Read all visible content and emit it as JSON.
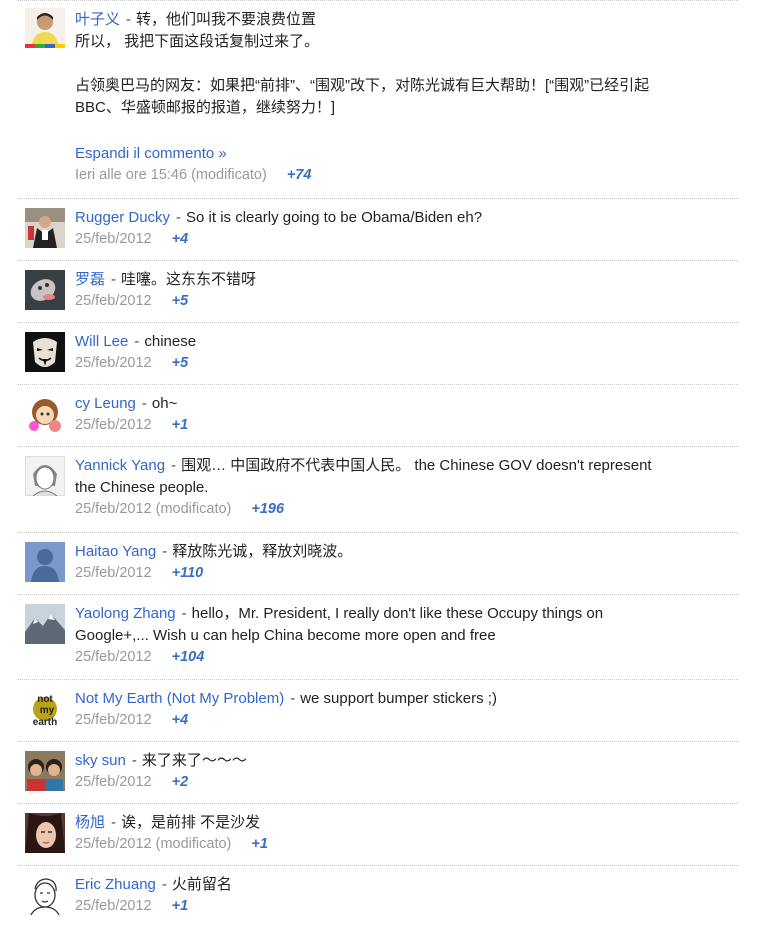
{
  "comments": [
    {
      "author": "叶子义",
      "text": "转，他们叫我不要浪费位置",
      "line2": "所以， 我把下面这段话复制过来了。",
      "para_a": "占领奥巴马的网友：如果把“前排”、“围观”改下，对陈光诚有巨大帮助！[“围观”已经引起",
      "para_b": "BBC、华盛顿邮报的报道，继续努力！]",
      "expand": "Espandi il commento »",
      "time": "Ieri alle ore 15:46 (modificato)",
      "plus": "+74"
    },
    {
      "author": "Rugger Ducky",
      "text": "So it is clearly going to be Obama/Biden eh?",
      "time": "25/feb/2012",
      "plus": "+4"
    },
    {
      "author": "罗磊",
      "text": "哇噻。这东东不错呀",
      "time": "25/feb/2012",
      "plus": "+5"
    },
    {
      "author": "Will Lee",
      "text": "chinese",
      "time": "25/feb/2012",
      "plus": "+5"
    },
    {
      "author": "cy Leung",
      "text": "oh~",
      "time": "25/feb/2012",
      "plus": "+1"
    },
    {
      "author": "Yannick Yang",
      "text": "围观… 中国政府不代表中国人民。 the Chinese GOV doesn't represent",
      "line2": "the Chinese people.",
      "time": "25/feb/2012 (modificato)",
      "plus": "+196"
    },
    {
      "author": "Haitao Yang",
      "text": "释放陈光诚，释放刘晓波。",
      "time": "25/feb/2012",
      "plus": "+110"
    },
    {
      "author": "Yaolong Zhang",
      "text": "hello，Mr. President, I really don't like these Occupy things on",
      "line2": "Google+,... Wish u can help China become more open and free",
      "time": "25/feb/2012",
      "plus": "+104"
    },
    {
      "author": "Not My Earth (Not My Problem)",
      "text": "we support bumper stickers ;)",
      "time": "25/feb/2012",
      "plus": "+4"
    },
    {
      "author": "sky sun",
      "text": "来了来了～～～",
      "time": "25/feb/2012",
      "plus": "+2"
    },
    {
      "author": "杨旭",
      "text": "诶，是前排 不是沙发",
      "time": "25/feb/2012 (modificato)",
      "plus": "+1"
    },
    {
      "author": "Eric Zhuang",
      "text": "火前留名",
      "time": "25/feb/2012",
      "plus": "+1"
    }
  ],
  "separator": "-",
  "avatar_logo_text": "not my earth",
  "colors": {
    "link": "#3366cc",
    "plus": "#3a6dc9",
    "meta": "#999999"
  }
}
